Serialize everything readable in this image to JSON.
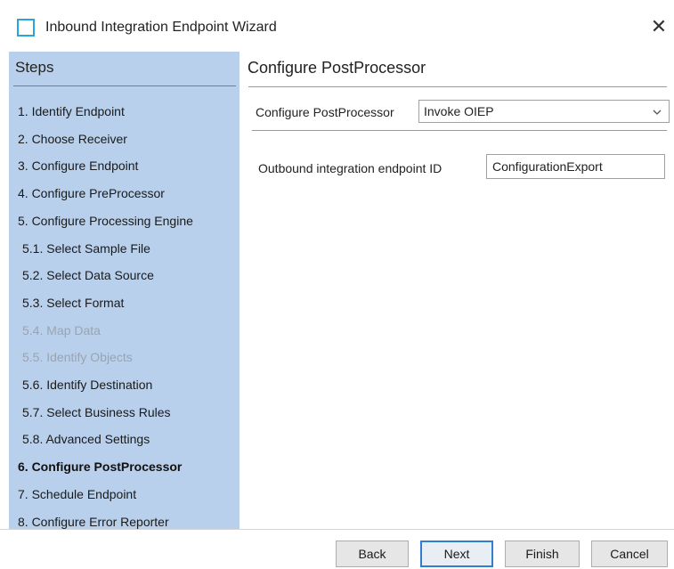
{
  "window": {
    "title": "Inbound Integration Endpoint Wizard",
    "close_glyph": "✕"
  },
  "steps": {
    "header": "Steps",
    "items": [
      {
        "label": "1. Identify Endpoint",
        "state": "normal"
      },
      {
        "label": "2. Choose Receiver",
        "state": "normal"
      },
      {
        "label": "3. Configure Endpoint",
        "state": "normal"
      },
      {
        "label": "4. Configure PreProcessor",
        "state": "normal"
      },
      {
        "label": "5. Configure Processing Engine",
        "state": "normal"
      },
      {
        "label": "5.1. Select Sample File",
        "state": "normal"
      },
      {
        "label": "5.2. Select Data Source",
        "state": "normal"
      },
      {
        "label": "5.3. Select Format",
        "state": "normal"
      },
      {
        "label": "5.4. Map Data",
        "state": "disabled"
      },
      {
        "label": "5.5. Identify Objects",
        "state": "disabled"
      },
      {
        "label": "5.6. Identify Destination",
        "state": "normal"
      },
      {
        "label": "5.7. Select Business Rules",
        "state": "normal"
      },
      {
        "label": "5.8. Advanced Settings",
        "state": "normal"
      },
      {
        "label": "6. Configure PostProcessor",
        "state": "active"
      },
      {
        "label": "7. Schedule Endpoint",
        "state": "normal"
      },
      {
        "label": "8. Configure Error Reporter",
        "state": "normal"
      }
    ]
  },
  "panel": {
    "title": "Configure PostProcessor",
    "postprocessor_label": "Configure PostProcessor",
    "postprocessor_value": "Invoke OIEP",
    "oiep_label": "Outbound integration endpoint ID",
    "oiep_value": "ConfigurationExport"
  },
  "buttons": {
    "back": "Back",
    "next": "Next",
    "finish": "Finish",
    "cancel": "Cancel"
  },
  "icons": {
    "app": "window-frame-icon",
    "close": "close-icon",
    "dropdown": "chevron-down-icon"
  },
  "colors": {
    "sidebar_bg": "#b8d0ec",
    "default_button_border": "#2f7fd1",
    "app_icon": "#2aa6d6"
  }
}
